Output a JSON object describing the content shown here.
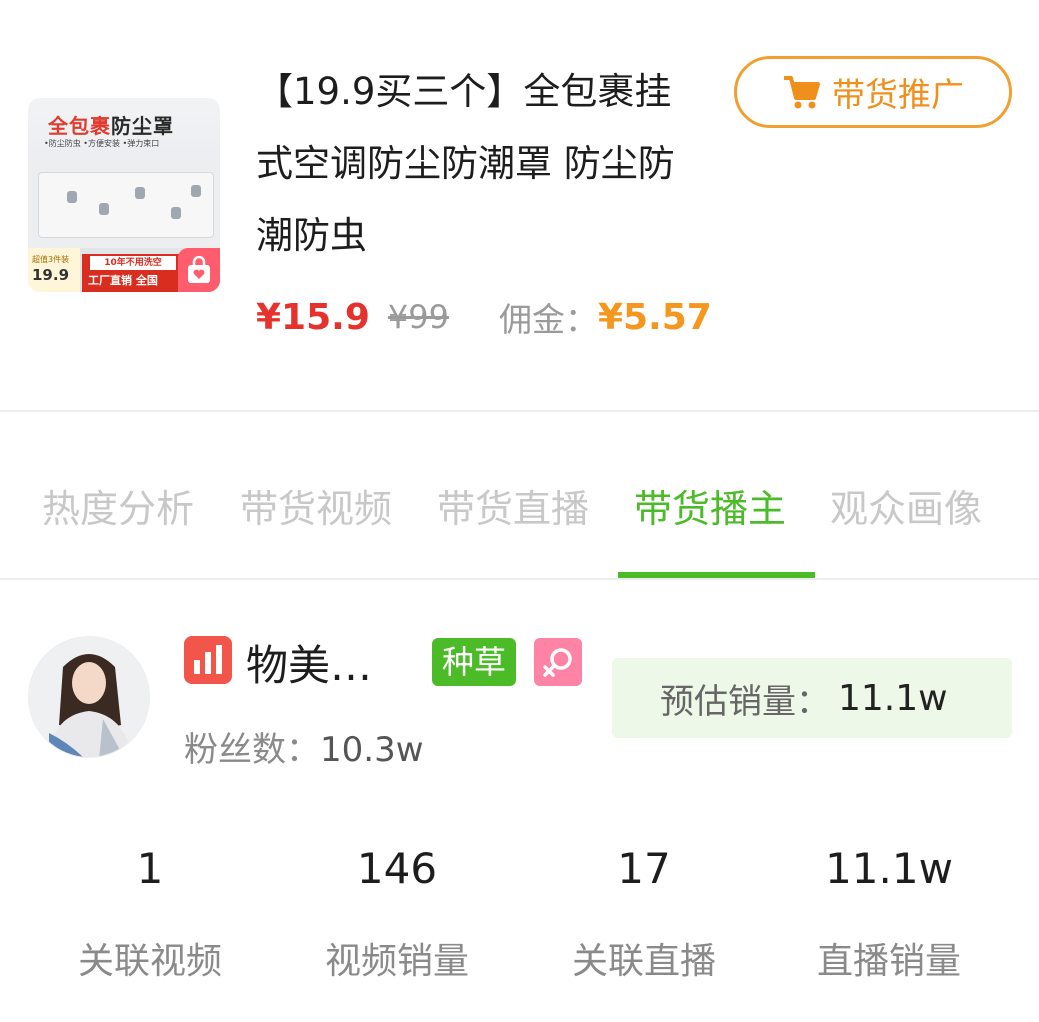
{
  "product": {
    "title": "【19.9买三个】全包裹挂式空调防尘防潮罩 防尘防潮防虫",
    "price": "¥15.9",
    "original_price": "¥99",
    "commission_label": "佣金：",
    "commission_value": "¥5.57",
    "promote_button": "带货推广",
    "thumbnail": {
      "title_red": "全包裹",
      "title_dark": "防尘罩",
      "tags": "•防尘防虫  •方便安装  •弹力束口",
      "promo_small": "超值3件装",
      "promo_price": "19.9",
      "promo_line1": "10年不用洗空",
      "promo_line2": "工厂直销 全国"
    }
  },
  "tabs": [
    {
      "label": "热度分析",
      "active": false
    },
    {
      "label": "带货视频",
      "active": false
    },
    {
      "label": "带货直播",
      "active": false
    },
    {
      "label": "带货播主",
      "active": true
    },
    {
      "label": "观众画像",
      "active": false
    }
  ],
  "anchor": {
    "name": "物美…",
    "tag": "种草",
    "fans_label": "粉丝数：",
    "fans_value": "10.3w",
    "estimated_sales_label": "预估销量：",
    "estimated_sales_value": "11.1w"
  },
  "stats": [
    {
      "value": "1",
      "label": "关联视频"
    },
    {
      "value": "146",
      "label": "视频销量"
    },
    {
      "value": "17",
      "label": "关联直播"
    },
    {
      "value": "11.1w",
      "label": "直播销量"
    }
  ],
  "colors": {
    "accent_green": "#4cbb28",
    "price_red": "#e5322d",
    "commission_orange": "#f5961e",
    "promote_border": "#f0a030"
  }
}
